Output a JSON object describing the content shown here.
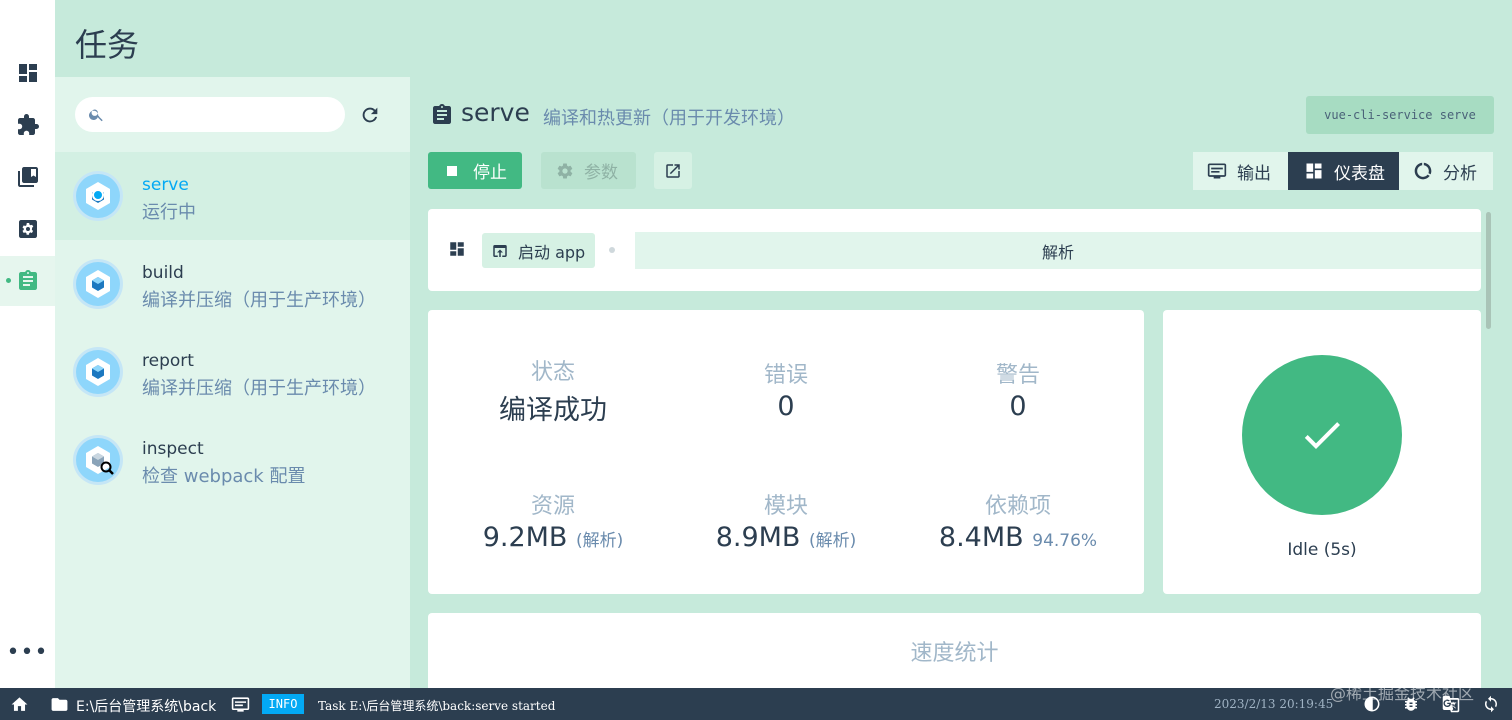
{
  "header": {
    "title": "任务"
  },
  "rail": {
    "items": [
      {
        "name": "dashboard-icon"
      },
      {
        "name": "plugins-icon"
      },
      {
        "name": "dependencies-icon"
      },
      {
        "name": "configuration-icon"
      },
      {
        "name": "tasks-icon",
        "active": true
      }
    ],
    "more_label": "•••"
  },
  "tasks": {
    "search": {
      "placeholder": "",
      "value": ""
    },
    "items": [
      {
        "name": "serve",
        "description": "运行中",
        "selected": true,
        "running": true
      },
      {
        "name": "build",
        "description": "编译并压缩（用于生产环境）"
      },
      {
        "name": "report",
        "description": "编译并压缩（用于生产环境）"
      },
      {
        "name": "inspect",
        "description": "检查 webpack 配置"
      }
    ]
  },
  "main": {
    "task_title": "serve",
    "task_subtitle": "编译和热更新（用于开发环境）",
    "command": "vue-cli-service serve",
    "buttons": {
      "stop": "停止",
      "params": "参数"
    },
    "views": {
      "output": "输出",
      "dashboard": "仪表盘",
      "analyze": "分析",
      "active": "dashboard"
    },
    "toolbar": {
      "launch": "启动 app",
      "parse": "解析"
    },
    "stats": {
      "status_label": "状态",
      "status_value": "编译成功",
      "errors_label": "错误",
      "errors_value": "0",
      "warnings_label": "警告",
      "warnings_value": "0",
      "assets_label": "资源",
      "assets_value": "9.2MB",
      "assets_note": "(解析)",
      "modules_label": "模块",
      "modules_value": "8.9MB",
      "modules_note": "(解析)",
      "deps_label": "依赖项",
      "deps_value": "8.4MB",
      "deps_percent": "94.76%"
    },
    "status_card": {
      "text": "Idle (5s)"
    },
    "speed": {
      "title": "速度统计"
    }
  },
  "statusbar": {
    "path": "E:\\后台管理系统\\back",
    "badge": "INFO",
    "message": "Task E:\\后台管理系统\\back:serve started",
    "time": "2023/2/13 20:19:45",
    "watermark": "@稀土掘金技术社区"
  },
  "colors": {
    "accent": "#42b983",
    "dark": "#2c3e50",
    "info": "#03a9f4",
    "background": "#c6eadb"
  }
}
